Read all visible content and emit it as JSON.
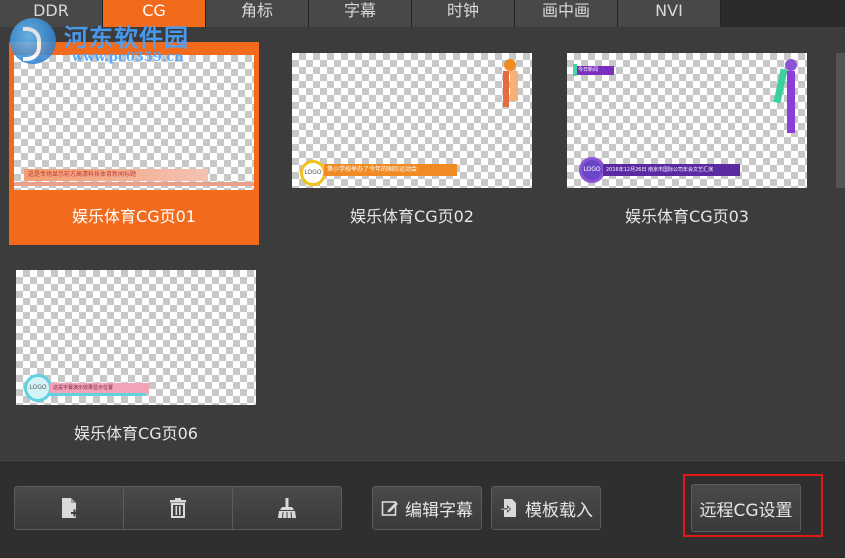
{
  "tabs": [
    {
      "label": "DDR",
      "active": false
    },
    {
      "label": "CG",
      "active": true
    },
    {
      "label": "角标",
      "active": false
    },
    {
      "label": "字幕",
      "active": false
    },
    {
      "label": "时钟",
      "active": false
    },
    {
      "label": "画中画",
      "active": false
    },
    {
      "label": "NVI",
      "active": false
    }
  ],
  "watermark": {
    "title": "河东软件园",
    "url": "www.pc0359.cn"
  },
  "templates": [
    {
      "name": "娱乐体育CG页01",
      "selected": true
    },
    {
      "name": "娱乐体育CG页02",
      "selected": false
    },
    {
      "name": "娱乐体育CG页03",
      "selected": false
    },
    {
      "name": "娱乐体育CG页06",
      "selected": false
    }
  ],
  "thumb_text": {
    "logo": "LOGO",
    "t1_bar": "这是专场显示前方高清科技体育新闻标题",
    "t2_bar": "第小学校举办了今年的国际运动会",
    "t3_top": "今日新闻",
    "t3_bar": "2016年12月26日 南京市国际公司年会文艺汇演",
    "t6_bar": "这是字幕演示效果显示位置"
  },
  "toolbar": {
    "new_icon": "new-file-icon",
    "delete_icon": "trash-icon",
    "clear_icon": "broom-icon",
    "edit_label": "编辑字幕",
    "load_label": "模板载入",
    "remote_label": "远程CG设置"
  },
  "colors": {
    "accent": "#f26b1d",
    "highlight": "#e01818"
  }
}
